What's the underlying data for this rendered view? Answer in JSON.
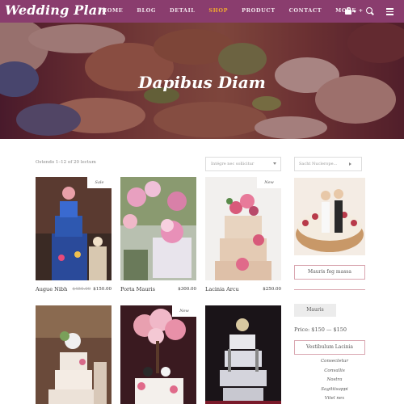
{
  "nav": {
    "logo": "Wedding Plan",
    "items": [
      {
        "label": "HOME"
      },
      {
        "label": "BLOG"
      },
      {
        "label": "DETAIL"
      },
      {
        "label": "SHOP",
        "active": true
      },
      {
        "label": "PRODUCT"
      },
      {
        "label": "CONTACT"
      },
      {
        "label": "MORE +"
      }
    ],
    "icons": [
      "cart-icon",
      "search-icon",
      "menu-icon"
    ],
    "background": "#8a3d6e",
    "active_color": "#f0a830"
  },
  "hero": {
    "title": "Dapibus Diam"
  },
  "shop": {
    "result_count": "Ostendo 1–12 of 20 lectum",
    "sort_placeholder": "Intégre nec sollicitur"
  },
  "products": [
    {
      "name": "Augue Nibh",
      "old_price": "$450.00",
      "price": "$150.00",
      "badge": "Sale"
    },
    {
      "name": "Porta Mauris",
      "price": "$300.00"
    },
    {
      "name": "Lacinia Arcu",
      "price": "$250.00",
      "badge": "New"
    },
    {
      "name": "",
      "price": ""
    },
    {
      "name": "",
      "price": "",
      "badge": "New"
    },
    {
      "name": "",
      "price": ""
    }
  ],
  "sidebar": {
    "search_placeholder": "Sacht Nuclerope…",
    "filter_button": "Mauris feg massa",
    "tag": "Mauris",
    "price": "Price: $150 — $150",
    "section_button": "Vestibulum Lacinia",
    "list": [
      "Consectetur",
      "Convallis",
      "Nostra",
      "Sagittisappi",
      "Vitel nex"
    ]
  }
}
